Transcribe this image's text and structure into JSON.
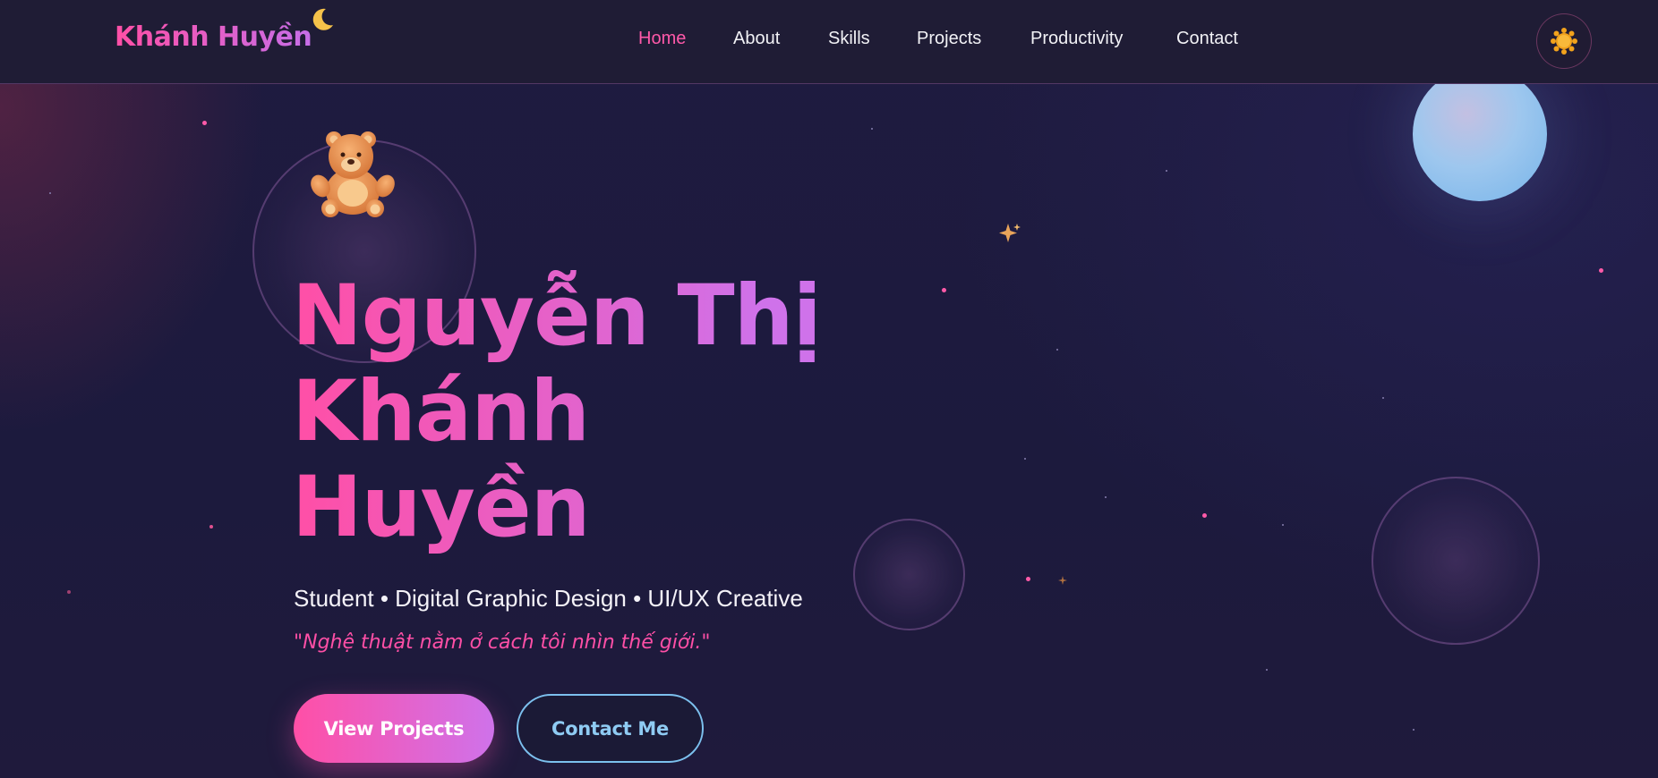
{
  "navbar": {
    "brand": "Khánh Huyền",
    "links": [
      {
        "label": "Home",
        "active": true
      },
      {
        "label": "About",
        "active": false
      },
      {
        "label": "Skills",
        "active": false
      },
      {
        "label": "Projects",
        "active": false
      },
      {
        "label": "Productivity",
        "active": false
      },
      {
        "label": "Contact",
        "active": false
      }
    ],
    "theme_toggle_icon": "sun-icon",
    "brand_icon": "moon-icon"
  },
  "hero": {
    "name_lines": [
      "Nguyễn Thị",
      "Khánh",
      "Huyền"
    ],
    "subtitle": "Student • Digital Graphic Design • UI/UX Creative",
    "quote": "\"Nghệ thuật nằm ở cách tôi nhìn thế giới.\"",
    "primary_button": "View Projects",
    "secondary_button": "Contact Me",
    "decoration_icons": [
      "teddy-bear-icon",
      "sparkle-icon",
      "moon-orb-icon"
    ]
  },
  "colors": {
    "accent_pink": "#ff4fa6",
    "accent_purple": "#cf72ea",
    "accent_blue": "#7cc0ee",
    "background": "#1d1a3c",
    "navbar": "#1f1c35"
  }
}
